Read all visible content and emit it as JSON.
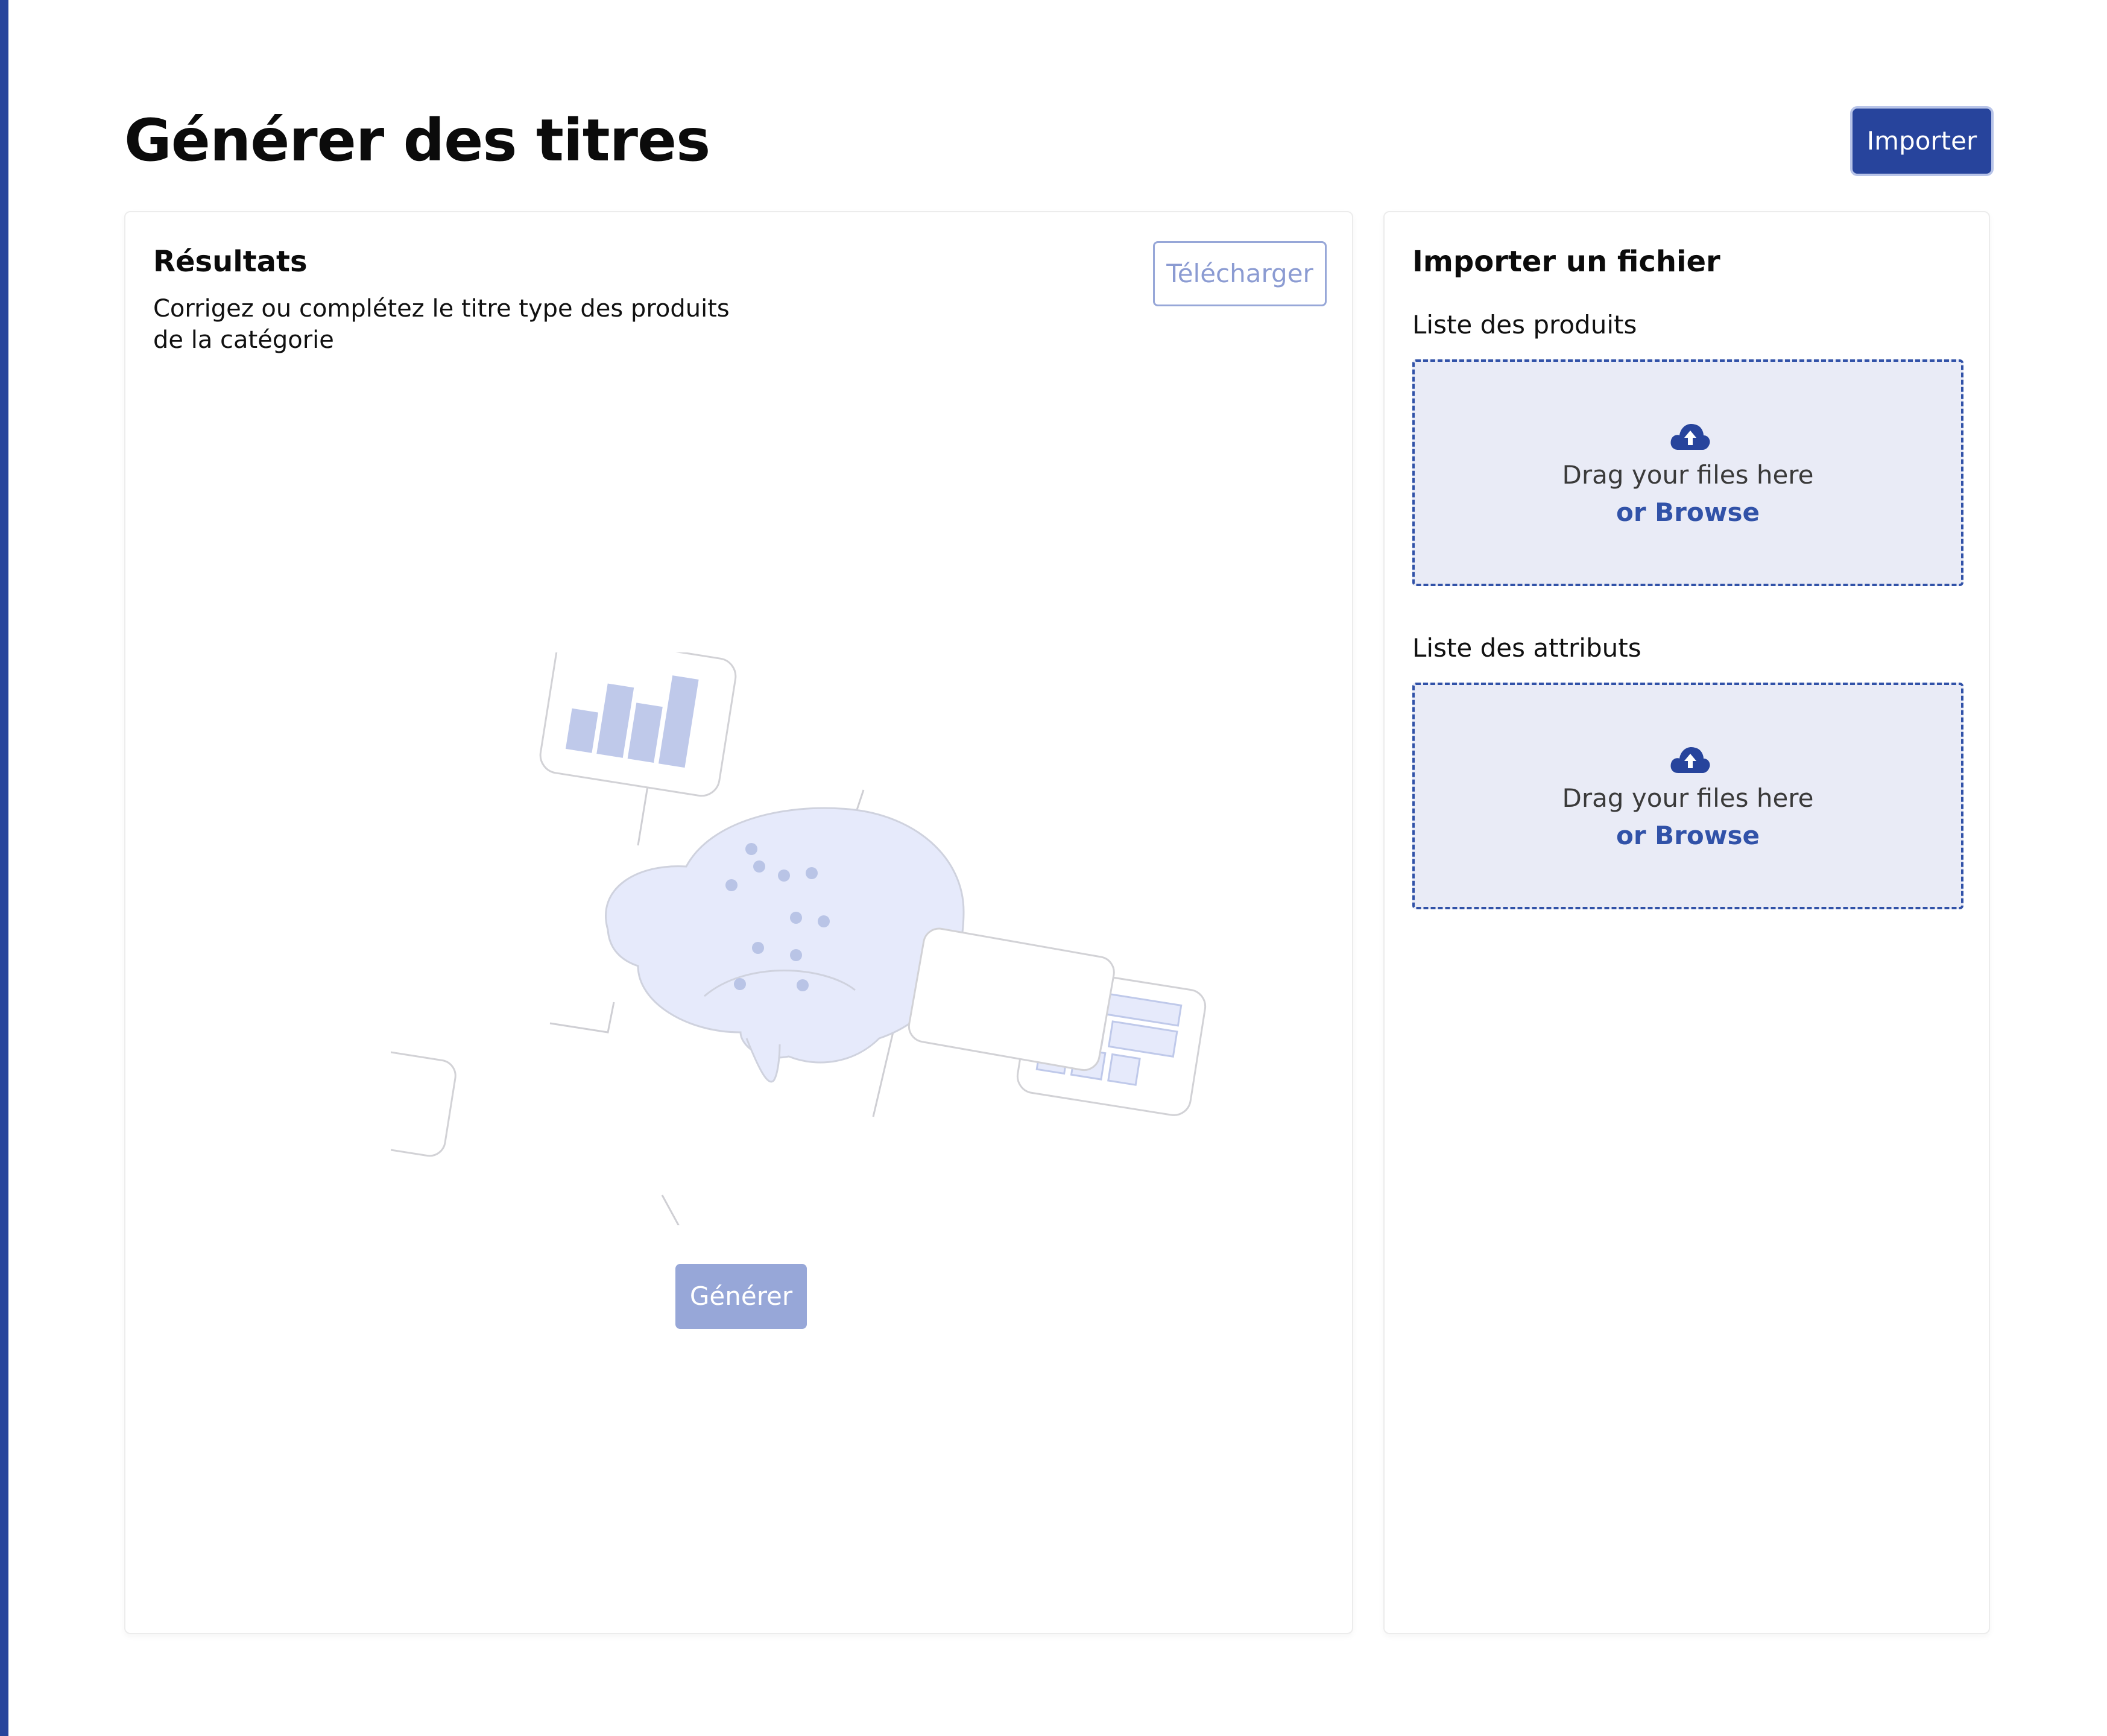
{
  "page": {
    "title": "Générer des titres",
    "import_button": "Importer"
  },
  "results": {
    "title": "Résultats",
    "subtitle": "Corrigez ou complétez le titre type des produits de la catégorie",
    "download_button": "Télécharger",
    "generate_button": "Générer",
    "illustration_icon": "ai-brain-illustration"
  },
  "import": {
    "title": "Importer un fichier",
    "products": {
      "label": "Liste des produits",
      "drop_text": "Drag your files here",
      "browse_text": "or Browse",
      "icon": "cloud-upload-icon"
    },
    "attributes": {
      "label": "Liste des attributs",
      "drop_text": "Drag your files here",
      "browse_text": "or Browse",
      "icon": "cloud-upload-icon"
    }
  },
  "colors": {
    "brand": "#27449c",
    "disabled": "#97a7d8",
    "dropzone_bg": "#e9ebf6",
    "illustration_fill": "#e6eafb",
    "illustration_accent": "#b9c4e6"
  }
}
